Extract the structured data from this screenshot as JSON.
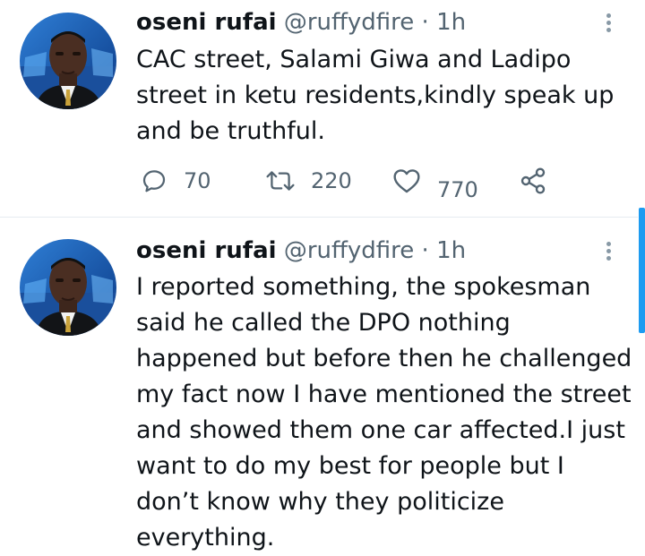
{
  "tweets": [
    {
      "author_name": "oseni rufai",
      "handle": "@ruffydfire",
      "separator": "·",
      "time": "1h",
      "text": "CAC street, Salami Giwa and Ladipo street in ketu residents,kindly speak up and be truthful.",
      "reply_count": "70",
      "retweet_count": "220",
      "like_count": "770"
    },
    {
      "author_name": "oseni rufai",
      "handle": "@ruffydfire",
      "separator": "·",
      "time": "1h",
      "text": "I reported something, the spokesman said he called the DPO nothing happened but before then he challenged my fact now I have mentioned the street and showed them one car affected.I just want to do my best for people but I don’t know why they politicize everything."
    }
  ],
  "icons": {
    "reply": "reply-icon",
    "retweet": "retweet-icon",
    "like": "heart-icon",
    "share": "share-icon",
    "more": "more-vertical-icon"
  },
  "colors": {
    "text": "#0f1419",
    "secondary": "#536471",
    "divider": "#e6ecf0",
    "scrollbar": "#1d9bf0"
  }
}
